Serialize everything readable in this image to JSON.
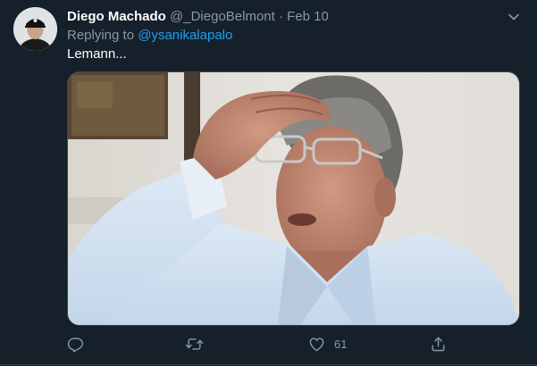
{
  "tweet": {
    "author_name": "Diego Machado",
    "author_handle": "@_DiegoBelmont",
    "separator": "·",
    "date": "Feb 10",
    "replying_prefix": "Replying to ",
    "replying_handle": "@ysanikalapalo",
    "text": "Lemann..."
  },
  "actions": {
    "reply": {
      "icon": "reply-icon",
      "count": ""
    },
    "retweet": {
      "icon": "retweet-icon",
      "count": ""
    },
    "like": {
      "icon": "heart-icon",
      "count": "61"
    },
    "share": {
      "icon": "share-icon",
      "count": ""
    }
  },
  "colors": {
    "background": "#15202b",
    "secondary_text": "#8899a6",
    "link": "#1da1f2",
    "border": "#38444d"
  }
}
